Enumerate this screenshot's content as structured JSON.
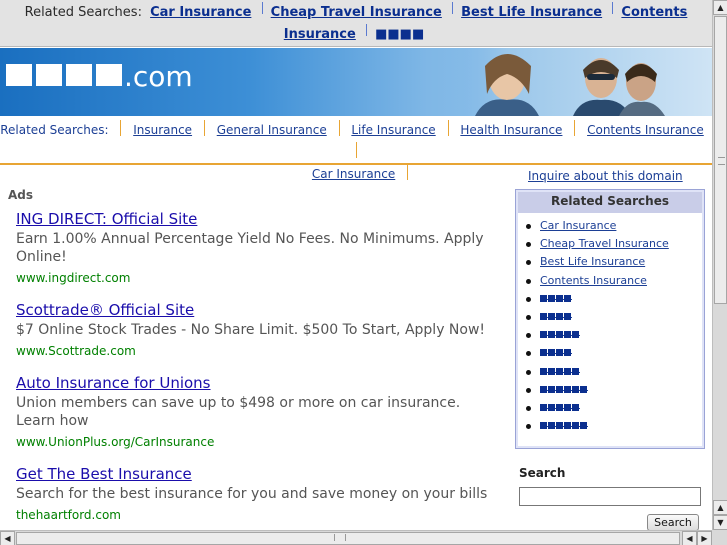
{
  "top_bar": {
    "label": "Related Searches:",
    "links": [
      "Car Insurance",
      "Cheap Travel Insurance",
      "Best Life Insurance",
      "Contents Insurance"
    ],
    "hidden_links": [
      4,
      4
    ]
  },
  "banner": {
    "domain_blocks": 4,
    "domain_suffix": ".com"
  },
  "nav": {
    "label": "Related Searches:",
    "links": [
      "Insurance",
      "General Insurance",
      "Life Insurance",
      "Health Insurance",
      "Contents Insurance",
      "Car Insurance"
    ]
  },
  "ads": {
    "label": "Ads",
    "items": [
      {
        "title": "ING DIRECT: Official Site",
        "description": "Earn 1.00% Annual Percentage Yield No Fees. No Minimums. Apply Online!",
        "url": "www.ingdirect.com"
      },
      {
        "title": "Scottrade® Official Site",
        "description": "$7 Online Stock Trades - No Share Limit. $500 To Start, Apply Now!",
        "url": "www.Scottrade.com"
      },
      {
        "title": "Auto Insurance for Unions",
        "description": "Union members can save up to $498 or more on car insurance. Learn how",
        "url": "www.UnionPlus.org/CarInsurance"
      },
      {
        "title": "Get The Best Insurance",
        "description": "Search for the best insurance for you and save money on your bills",
        "url": "thehaartford.com"
      }
    ]
  },
  "sidebar": {
    "inquire_link": "Inquire about this domain",
    "related_title": "Related Searches",
    "related_links": [
      "Car Insurance",
      "Cheap Travel Insurance",
      "Best Life Insurance",
      "Contents Insurance"
    ],
    "hidden_links": [
      4,
      4,
      5,
      4,
      5,
      6,
      5,
      6
    ],
    "search_label": "Search",
    "search_value": "",
    "search_button": "Search"
  },
  "colors": {
    "link": "#1c3f95",
    "ad_title": "#1a0dab",
    "ad_url": "#008000",
    "accent_orange": "#e8a534"
  }
}
